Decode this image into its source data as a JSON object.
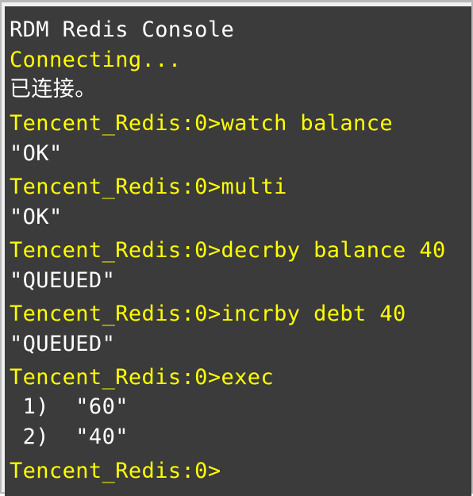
{
  "console": {
    "title": "RDM Redis Console",
    "connecting": "Connecting...",
    "connected": "已连接。",
    "prompt": "Tencent_Redis:0>",
    "entries": [
      {
        "command": "watch balance",
        "response": "\"OK\""
      },
      {
        "command": "multi",
        "response": "\"OK\""
      },
      {
        "command": "decrby balance 40",
        "response": "\"QUEUED\""
      },
      {
        "command": "incrby debt 40",
        "response": "\"QUEUED\""
      },
      {
        "command": "exec",
        "response_items": [
          " 1)  \"60\"",
          " 2)  \"40\""
        ]
      }
    ],
    "final_prompt": "Tencent_Redis:0>"
  },
  "colors": {
    "background": "#3b3b3b",
    "prompt_text": "#ffff00",
    "output_text": "#ffffff"
  }
}
